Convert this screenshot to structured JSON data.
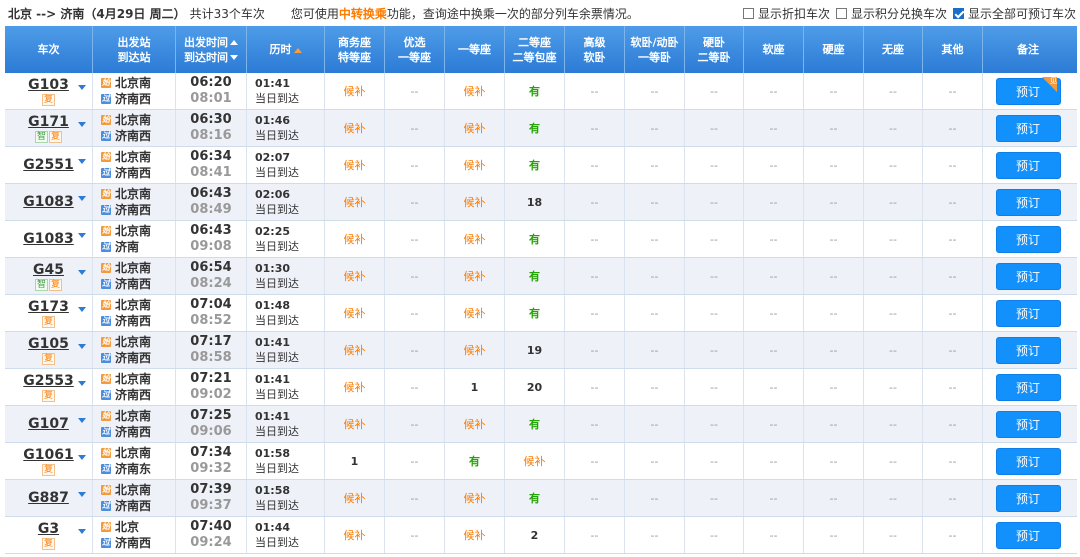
{
  "topbar": {
    "route": "北京 --> 济南（4月29日 周二）",
    "total": "共计33个车次",
    "notice_pre": "您可使用",
    "notice_link": "中转换乘",
    "notice_post": "功能，查询途中换乘一次的部分列车余票情况。",
    "opt1": "显示折扣车次",
    "opt2": "显示积分兑换车次",
    "opt3": "显示全部可预订车次",
    "opt1_checked": false,
    "opt2_checked": false,
    "opt3_checked": true
  },
  "header": {
    "train": "车次",
    "station1": "出发站",
    "station2": "到达站",
    "time1": "出发时间",
    "time2": "到达时间",
    "duration": "历时",
    "seats": [
      [
        "商务座",
        "特等座"
      ],
      [
        "优选",
        "一等座"
      ],
      [
        "一等座",
        ""
      ],
      [
        "二等座",
        "二等包座"
      ],
      [
        "高级",
        "软卧"
      ],
      [
        "软卧/动卧",
        "一等卧"
      ],
      [
        "硬卧",
        "二等卧"
      ],
      [
        "软座",
        ""
      ],
      [
        "硬座",
        ""
      ],
      [
        "无座",
        ""
      ],
      [
        "其他",
        ""
      ]
    ],
    "note": "备注"
  },
  "book_label": "预订",
  "corner_label": "见",
  "arrive_today": "当日到达",
  "icons": {
    "start": "始",
    "pass": "过"
  },
  "rows": [
    {
      "train": "G103",
      "tags": [
        "复"
      ],
      "from": "北京南",
      "fromType": "start",
      "to": "济南西",
      "dep": "06:20",
      "arr": "08:01",
      "dur": "01:41",
      "seats": [
        "候补",
        "--",
        "候补",
        "有",
        "--",
        "--",
        "--",
        "--",
        "--",
        "--",
        "--"
      ],
      "corner": true
    },
    {
      "train": "G171",
      "tags": [
        "智",
        "复"
      ],
      "from": "北京南",
      "fromType": "start",
      "to": "济南西",
      "dep": "06:30",
      "arr": "08:16",
      "dur": "01:46",
      "seats": [
        "候补",
        "--",
        "候补",
        "有",
        "--",
        "--",
        "--",
        "--",
        "--",
        "--",
        "--"
      ]
    },
    {
      "train": "G2551",
      "tags": [],
      "from": "北京南",
      "fromType": "start",
      "to": "济南西",
      "dep": "06:34",
      "arr": "08:41",
      "dur": "02:07",
      "seats": [
        "候补",
        "--",
        "候补",
        "有",
        "--",
        "--",
        "--",
        "--",
        "--",
        "--",
        "--"
      ]
    },
    {
      "train": "G1083",
      "tags": [],
      "from": "北京南",
      "fromType": "start",
      "to": "济南西",
      "dep": "06:43",
      "arr": "08:49",
      "dur": "02:06",
      "seats": [
        "候补",
        "--",
        "候补",
        "18",
        "--",
        "--",
        "--",
        "--",
        "--",
        "--",
        "--"
      ]
    },
    {
      "train": "G1083",
      "tags": [],
      "from": "北京南",
      "fromType": "start",
      "to": "济南",
      "dep": "06:43",
      "arr": "09:08",
      "dur": "02:25",
      "seats": [
        "候补",
        "--",
        "候补",
        "有",
        "--",
        "--",
        "--",
        "--",
        "--",
        "--",
        "--"
      ]
    },
    {
      "train": "G45",
      "tags": [
        "智",
        "复"
      ],
      "from": "北京南",
      "fromType": "start",
      "to": "济南西",
      "dep": "06:54",
      "arr": "08:24",
      "dur": "01:30",
      "seats": [
        "候补",
        "--",
        "候补",
        "有",
        "--",
        "--",
        "--",
        "--",
        "--",
        "--",
        "--"
      ]
    },
    {
      "train": "G173",
      "tags": [
        "复"
      ],
      "from": "北京南",
      "fromType": "start",
      "to": "济南西",
      "dep": "07:04",
      "arr": "08:52",
      "dur": "01:48",
      "seats": [
        "候补",
        "--",
        "候补",
        "有",
        "--",
        "--",
        "--",
        "--",
        "--",
        "--",
        "--"
      ]
    },
    {
      "train": "G105",
      "tags": [
        "复"
      ],
      "from": "北京南",
      "fromType": "start",
      "to": "济南西",
      "dep": "07:17",
      "arr": "08:58",
      "dur": "01:41",
      "seats": [
        "候补",
        "--",
        "候补",
        "19",
        "--",
        "--",
        "--",
        "--",
        "--",
        "--",
        "--"
      ]
    },
    {
      "train": "G2553",
      "tags": [
        "复"
      ],
      "from": "北京南",
      "fromType": "start",
      "to": "济南西",
      "dep": "07:21",
      "arr": "09:02",
      "dur": "01:41",
      "seats": [
        "候补",
        "--",
        "1",
        "20",
        "--",
        "--",
        "--",
        "--",
        "--",
        "--",
        "--"
      ]
    },
    {
      "train": "G107",
      "tags": [],
      "from": "北京南",
      "fromType": "start",
      "to": "济南西",
      "dep": "07:25",
      "arr": "09:06",
      "dur": "01:41",
      "seats": [
        "候补",
        "--",
        "候补",
        "有",
        "--",
        "--",
        "--",
        "--",
        "--",
        "--",
        "--"
      ]
    },
    {
      "train": "G1061",
      "tags": [
        "复"
      ],
      "from": "北京南",
      "fromType": "start",
      "to": "济南东",
      "dep": "07:34",
      "arr": "09:32",
      "dur": "01:58",
      "seats": [
        "1",
        "--",
        "有",
        "候补",
        "--",
        "--",
        "--",
        "--",
        "--",
        "--",
        "--"
      ]
    },
    {
      "train": "G887",
      "tags": [],
      "from": "北京南",
      "fromType": "start",
      "to": "济南西",
      "dep": "07:39",
      "arr": "09:37",
      "dur": "01:58",
      "seats": [
        "候补",
        "--",
        "候补",
        "有",
        "--",
        "--",
        "--",
        "--",
        "--",
        "--",
        "--"
      ]
    },
    {
      "train": "G3",
      "tags": [
        "复"
      ],
      "from": "北京",
      "fromType": "start",
      "to": "济南西",
      "dep": "07:40",
      "arr": "09:24",
      "dur": "01:44",
      "seats": [
        "候补",
        "--",
        "候补",
        "2",
        "--",
        "--",
        "--",
        "--",
        "--",
        "--",
        "--"
      ]
    }
  ]
}
